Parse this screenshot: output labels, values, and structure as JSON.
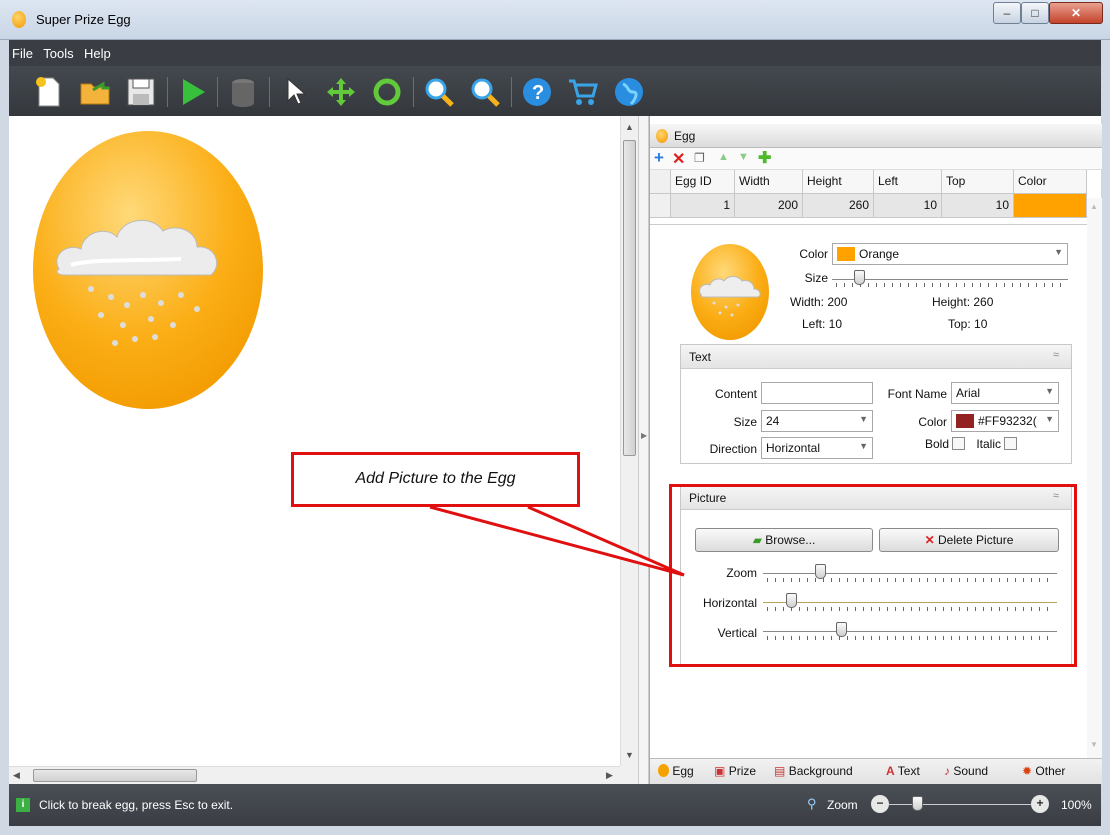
{
  "window": {
    "title": "Super Prize Egg",
    "min": "–",
    "max": "□",
    "close": "✕"
  },
  "menu": [
    "File",
    "Tools",
    "Help"
  ],
  "toolbar_icons": [
    "new-icon",
    "open-icon",
    "save-icon",
    "play-icon",
    "database-icon",
    "pointer-icon",
    "move-icon",
    "rotate-icon",
    "zoom-in-icon",
    "zoom-out-icon",
    "help-icon",
    "cart-icon",
    "globe-icon"
  ],
  "panel": {
    "title": "Egg",
    "toolbar_icons": [
      "add-icon",
      "delete-icon",
      "copy-icon",
      "move-up-icon",
      "move-down-icon",
      "add-child-icon"
    ],
    "grid": {
      "columns": [
        "Egg ID",
        "Width",
        "Height",
        "Left",
        "Top",
        "Color"
      ],
      "rows": [
        {
          "egg_id": "1",
          "width": "200",
          "height": "260",
          "left": "10",
          "top": "10",
          "color": "#ffa200"
        }
      ]
    },
    "egg": {
      "color_label": "Color",
      "color_value": "Orange",
      "color_hex": "#ffa200",
      "size_label": "Size",
      "width": "Width: 200",
      "height": "Height: 260",
      "left": "Left: 10",
      "top": "Top: 10"
    },
    "text_group": {
      "title": "Text",
      "content_label": "Content",
      "content_value": "",
      "font_name_label": "Font Name",
      "font_name_value": "Arial",
      "size_label": "Size",
      "size_value": "24",
      "color_label": "Color",
      "color_value": "#FF93232(",
      "color_hex": "#932323",
      "direction_label": "Direction",
      "direction_value": "Horizontal",
      "bold_label": "Bold",
      "italic_label": "Italic"
    },
    "picture_group": {
      "title": "Picture",
      "browse_label": "Browse...",
      "delete_label": "Delete Picture",
      "zoom_label": "Zoom",
      "horizontal_label": "Horizontal",
      "vertical_label": "Vertical"
    },
    "tabs": [
      "Egg",
      "Prize",
      "Background",
      "Text",
      "Sound",
      "Other"
    ]
  },
  "callout": "Add Picture to the Egg",
  "status": {
    "message": "Click to break egg, press Esc to exit.",
    "zoom_label": "Zoom",
    "zoom_value": "100%"
  }
}
